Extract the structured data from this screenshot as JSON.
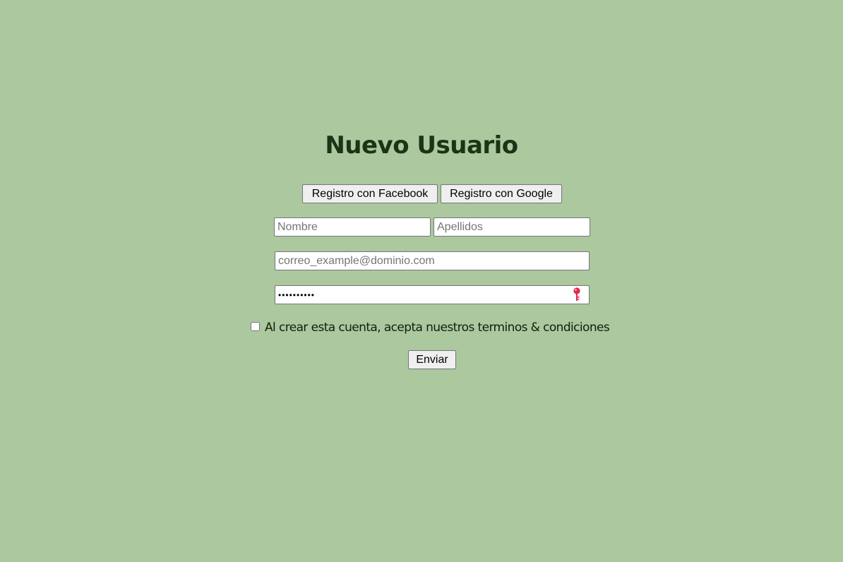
{
  "form": {
    "title": "Nuevo Usuario",
    "social": {
      "facebook_label": "Registro con Facebook",
      "google_label": "Registro con Google"
    },
    "fields": {
      "nombre_placeholder": "Nombre",
      "apellidos_placeholder": "Apellidos",
      "email_placeholder": "correo_example@dominio.com",
      "password_value": "••••••••••"
    },
    "terms_label": "Al crear esta cuenta, acepta nuestros terminos & condiciones",
    "terms_checked": false,
    "submit_label": "Enviar"
  },
  "icons": {
    "password_field": "key-icon"
  },
  "colors": {
    "background": "#abc89f",
    "title": "#1b3415",
    "key_icon": "#e3284b"
  }
}
